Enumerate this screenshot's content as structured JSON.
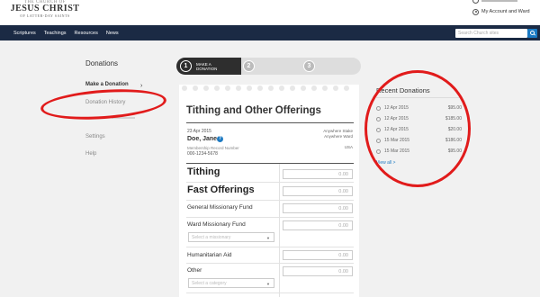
{
  "header": {
    "logo_line1": "THE CHURCH OF",
    "logo_line2": "JESUS CHRIST",
    "logo_line3": "OF LATTER-DAY SAINTS",
    "account_label": "My Account and Ward",
    "search_placeholder": "Search Church sites"
  },
  "nav": {
    "items": [
      "Scriptures",
      "Teachings",
      "Resources",
      "News"
    ]
  },
  "sidebar": {
    "title": "Donations",
    "items": [
      {
        "label": "Make a Donation",
        "active": true
      },
      {
        "label": "Donation History",
        "active": false
      },
      {
        "label": "Settings",
        "active": false
      },
      {
        "label": "Help",
        "active": false
      }
    ]
  },
  "steps": [
    {
      "num": "1",
      "label_l1": "MAKE A",
      "label_l2": "DONATION"
    },
    {
      "num": "2",
      "label_l1": "",
      "label_l2": ""
    },
    {
      "num": "3",
      "label_l1": "",
      "label_l2": ""
    }
  ],
  "form": {
    "title": "Tithing and Other Offerings",
    "date": "23 Apr 2015",
    "donor_name": "Doe, Jane",
    "member_label": "Membership Record Number",
    "member_number": "000-1234-5678",
    "unit_stake": "Anywhere Stake",
    "unit_ward": "Anywhere Ward",
    "unit_country": "USA",
    "fields": [
      {
        "label": "Tithing",
        "value": "0.00"
      },
      {
        "label": "Fast Offerings",
        "value": "0.00"
      },
      {
        "label": "General Missionary Fund",
        "value": "0.00"
      },
      {
        "label": "Ward Missionary Fund",
        "value": "0.00",
        "select": "Select a missionary"
      },
      {
        "label": "Humanitarian Aid",
        "value": "0.00"
      },
      {
        "label": "Other",
        "value": "0.00",
        "select": "Select a category"
      }
    ]
  },
  "recent": {
    "title": "Recent Donations",
    "rows": [
      {
        "date": "12 Apr 2015",
        "amount": "$95.00"
      },
      {
        "date": "12 Apr 2015",
        "amount": "$185.00"
      },
      {
        "date": "12 Apr 2015",
        "amount": "$20.00"
      },
      {
        "date": "15 Mar 2015",
        "amount": "$186.00"
      },
      {
        "date": "15 Mar 2015",
        "amount": "$95.00"
      }
    ],
    "view_all": "View all >"
  },
  "colors": {
    "navbar": "#1b2a44",
    "accent": "#1f7bc2",
    "annotation": "#e11b1b"
  }
}
